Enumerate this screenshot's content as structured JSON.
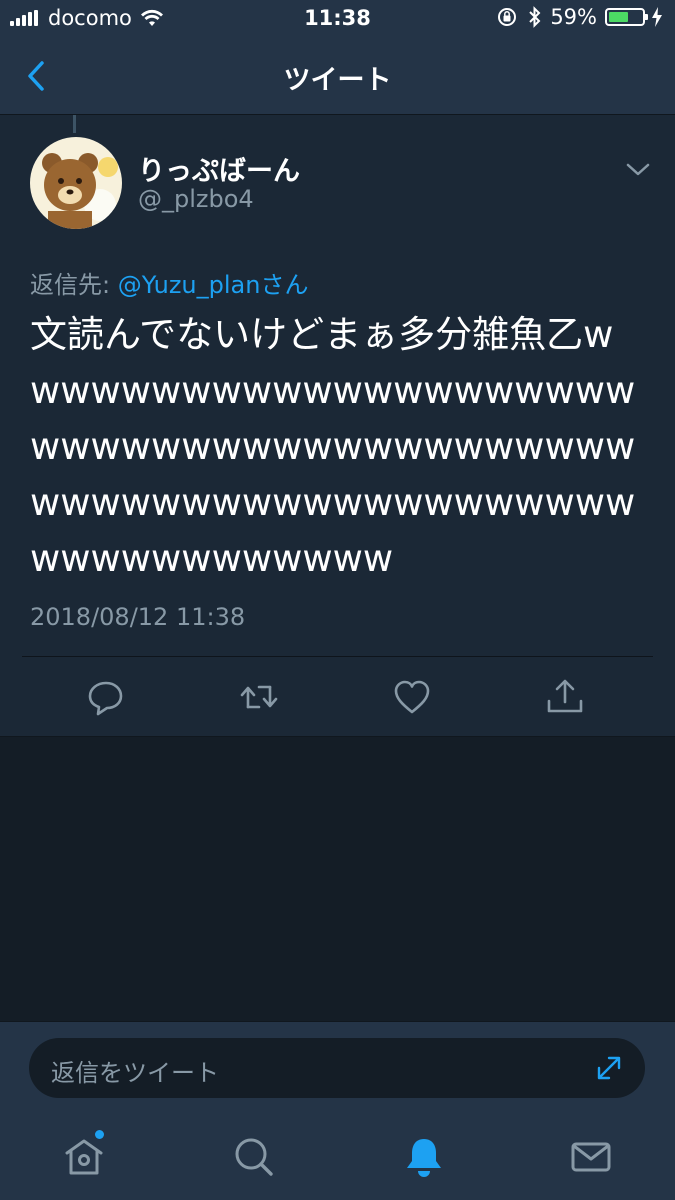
{
  "status_bar": {
    "carrier": "docomo",
    "time": "11:38",
    "battery_percent_label": "59%",
    "battery_level": 0.59,
    "icons": [
      "signal-icon",
      "wifi-icon",
      "orientation-lock-icon",
      "bluetooth-icon",
      "battery-icon",
      "charging-icon"
    ]
  },
  "nav": {
    "title": "ツイート",
    "back_icon": "chevron-left-icon"
  },
  "tweet": {
    "display_name": "りっぷばーん",
    "handle": "@_plzbo4",
    "reply_prefix": "返信先: ",
    "reply_mention": "@Yuzu_planさん",
    "text": "文読んでないけどまぁ多分雑魚乙wwwwwwwwwwwwwwwwwwwwwwwwwwwwwwwwwwwwwwwwwwwwwwwwwwwwwwwwwwwwwwwwwwwwwwwww",
    "timestamp": "2018/08/12 11:38",
    "actions": [
      "reply-icon",
      "retweet-icon",
      "like-icon",
      "share-icon"
    ]
  },
  "composer": {
    "placeholder": "返信をツイート",
    "expand_icon": "expand-icon"
  },
  "tab_bar": {
    "tabs": [
      "home-icon",
      "search-icon",
      "notifications-icon",
      "messages-icon"
    ],
    "active": "notifications-icon"
  },
  "colors": {
    "background": "#141d26",
    "bar": "#243447",
    "card": "#1b2836",
    "accent": "#1da1f2",
    "secondary_text": "#8899a6",
    "battery": "#4cd964"
  }
}
